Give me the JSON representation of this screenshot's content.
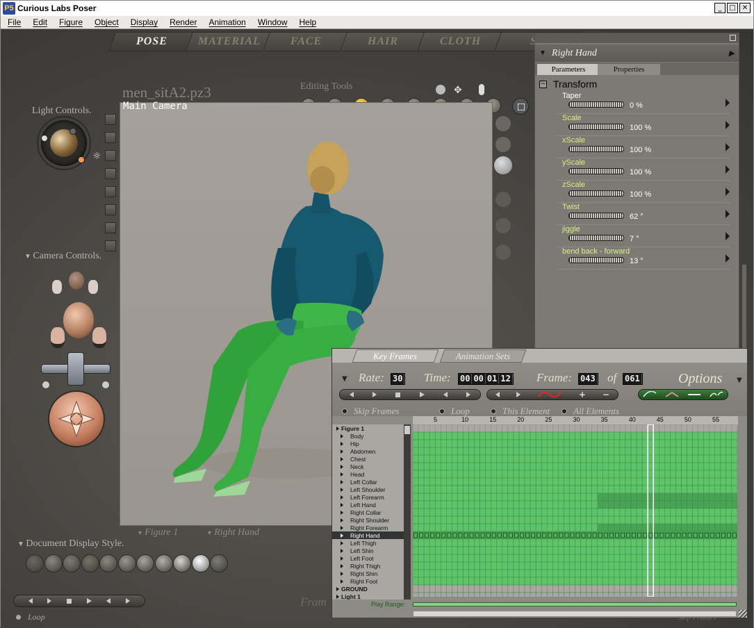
{
  "window": {
    "title": "Curious Labs Poser",
    "logo": "P5"
  },
  "menu": [
    "File",
    "Edit",
    "Figure",
    "Object",
    "Display",
    "Render",
    "Animation",
    "Window",
    "Help"
  ],
  "room_tabs": [
    {
      "label": "POSE",
      "active": true
    },
    {
      "label": "MATERIAL",
      "active": false
    },
    {
      "label": "FACE",
      "active": false
    },
    {
      "label": "HAIR",
      "active": false
    },
    {
      "label": "CLOTH",
      "active": false
    },
    {
      "label": "SE",
      "active": false
    }
  ],
  "left": {
    "light_controls": "Light Controls.",
    "camera_controls": "Camera Controls.",
    "document_display_style": "Document Display Style.",
    "loop_label": "Loop"
  },
  "document": {
    "name": "men_sitA2.pz3",
    "camera": "Main Camera",
    "editing_tools": "Editing Tools"
  },
  "below_viewport": {
    "figure": "Figure 1",
    "actor": "Right Hand"
  },
  "bottom_frame_label": "Fram",
  "bottom_skip_label": "Skip Frames",
  "parameters": {
    "title": "Right Hand",
    "tabs": [
      "Parameters",
      "Properties"
    ],
    "group": "Transform",
    "items": [
      {
        "name": "Taper",
        "value": "0 %",
        "name_color": "#ffffff"
      },
      {
        "name": "Scale",
        "value": "100 %",
        "name_color": "#d8ef85"
      },
      {
        "name": "xScale",
        "value": "100 %",
        "name_color": "#d8ef85"
      },
      {
        "name": "yScale",
        "value": "100 %",
        "name_color": "#d8ef85"
      },
      {
        "name": "zScale",
        "value": "100 %",
        "name_color": "#d8ef85"
      },
      {
        "name": "Twist",
        "value": "62 °",
        "name_color": "#d8ef85"
      },
      {
        "name": "jiggle",
        "value": "7 °",
        "name_color": "#d8ef85"
      },
      {
        "name": "bend back - forward",
        "value": "13 °",
        "name_color": "#d8ef85"
      }
    ]
  },
  "keyframes": {
    "tabs": [
      "Key Frames",
      "Animation Sets"
    ],
    "rate_label": "Rate:",
    "rate": "30",
    "time_label": "Time:",
    "time": [
      "00",
      "00",
      "01",
      "12"
    ],
    "frame_label": "Frame:",
    "frame": "043",
    "of_label": "of",
    "total": "061",
    "options": "Options",
    "skip_frames": "Skip Frames",
    "loop": "Loop",
    "this_element": "This Element",
    "all_elements": "All Elements",
    "ruler": [
      "5",
      "10",
      "15",
      "20",
      "25",
      "30",
      "35",
      "40",
      "45",
      "50",
      "55"
    ],
    "tree": [
      {
        "label": "Figure 1",
        "level": 0,
        "selected": false
      },
      {
        "label": "Body",
        "level": 1,
        "selected": false
      },
      {
        "label": "Hip",
        "level": 1,
        "selected": false
      },
      {
        "label": "Abdomen",
        "level": 1,
        "selected": false
      },
      {
        "label": "Chest",
        "level": 1,
        "selected": false
      },
      {
        "label": "Neck",
        "level": 1,
        "selected": false
      },
      {
        "label": "Head",
        "level": 1,
        "selected": false
      },
      {
        "label": "Left Collar",
        "level": 1,
        "selected": false
      },
      {
        "label": "Left Shoulder",
        "level": 1,
        "selected": false
      },
      {
        "label": "Left Forearm",
        "level": 1,
        "selected": false
      },
      {
        "label": "Left Hand",
        "level": 1,
        "selected": false
      },
      {
        "label": "Right Collar",
        "level": 1,
        "selected": false
      },
      {
        "label": "Right Shoulder",
        "level": 1,
        "selected": false
      },
      {
        "label": "Right Forearm",
        "level": 1,
        "selected": false
      },
      {
        "label": "Right Hand",
        "level": 1,
        "selected": true
      },
      {
        "label": "Left Thigh",
        "level": 1,
        "selected": false
      },
      {
        "label": "Left Shin",
        "level": 1,
        "selected": false
      },
      {
        "label": "Left Foot",
        "level": 1,
        "selected": false
      },
      {
        "label": "Right Thigh",
        "level": 1,
        "selected": false
      },
      {
        "label": "Right Shin",
        "level": 1,
        "selected": false
      },
      {
        "label": "Right Foot",
        "level": 1,
        "selected": false
      },
      {
        "label": "GROUND",
        "level": 0,
        "selected": false
      },
      {
        "label": "Light 1",
        "level": 0,
        "selected": false
      }
    ],
    "play_range": "Play Range:"
  }
}
